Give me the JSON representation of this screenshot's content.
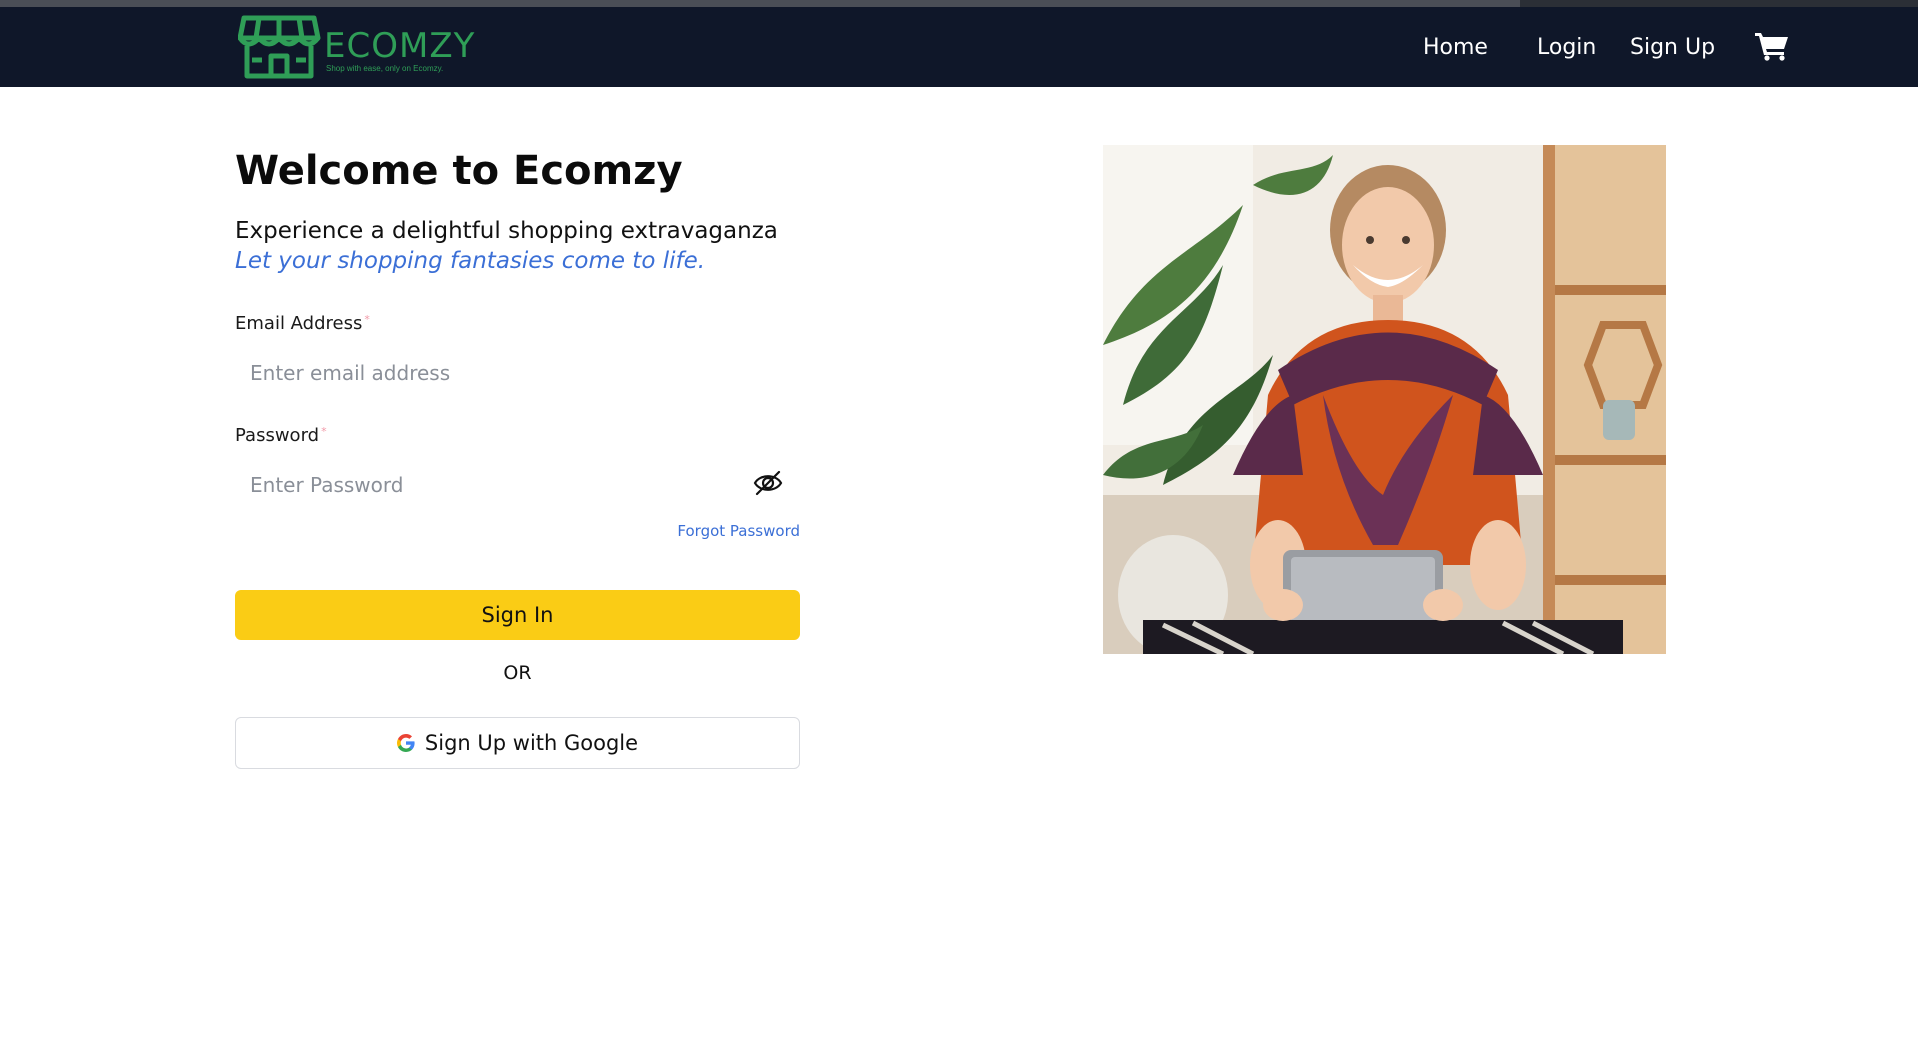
{
  "brand": {
    "name": "ECOMZY",
    "tagline": "Shop with ease, only on Ecomzy.",
    "color": "#2f9e57"
  },
  "nav": {
    "links": [
      "Home",
      "Login",
      "Sign Up"
    ],
    "cart_icon": "shopping-cart-icon",
    "background": "#0f1729"
  },
  "login": {
    "title": "Welcome to Ecomzy",
    "subtitle": "Experience a delightful shopping extravaganza",
    "tagline": "Let your shopping fantasies come to life.",
    "email_label": "Email Address",
    "email_placeholder": "Enter email address",
    "email_value": "",
    "password_label": "Password",
    "password_placeholder": "Enter Password",
    "password_value": "",
    "required_marker": "*",
    "password_toggle_icon": "eye-off-icon",
    "forgot_link": "Forgot Password",
    "signin_button": "Sign In",
    "divider": "OR",
    "google_button": "Sign Up with Google",
    "google_icon": "google-logo-icon"
  },
  "colors": {
    "accent_button": "#facc15",
    "link": "#3b6fd6",
    "required": "#f29aa8"
  },
  "hero_image": {
    "description_icon": "hero-photo"
  }
}
